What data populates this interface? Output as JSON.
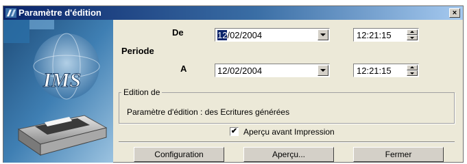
{
  "window": {
    "title": "Paramètre d'édition",
    "close_label": "×"
  },
  "branding": {
    "logo_text": "IMS"
  },
  "form": {
    "de_label": "De",
    "periode_label": "Periode",
    "a_label": "A",
    "date_from_selected": "12",
    "date_from_rest": "/02/2004",
    "time_from": "12:21:15",
    "date_to": "12/02/2004",
    "time_to": "12:21:15"
  },
  "edition_group": {
    "legend": "Edition de",
    "text": "Paramètre d'édition : des Ecritures générées"
  },
  "preview_option": {
    "label": "Aperçu avant Impression",
    "checked": true,
    "check_mark": "✔"
  },
  "buttons": {
    "configuration": "Configuration",
    "preview": "Aperçu...",
    "close": "Fermer"
  },
  "colors": {
    "title_start": "#0a246a",
    "title_end": "#a6caf0",
    "dialog_bg": "#ece9d8"
  }
}
